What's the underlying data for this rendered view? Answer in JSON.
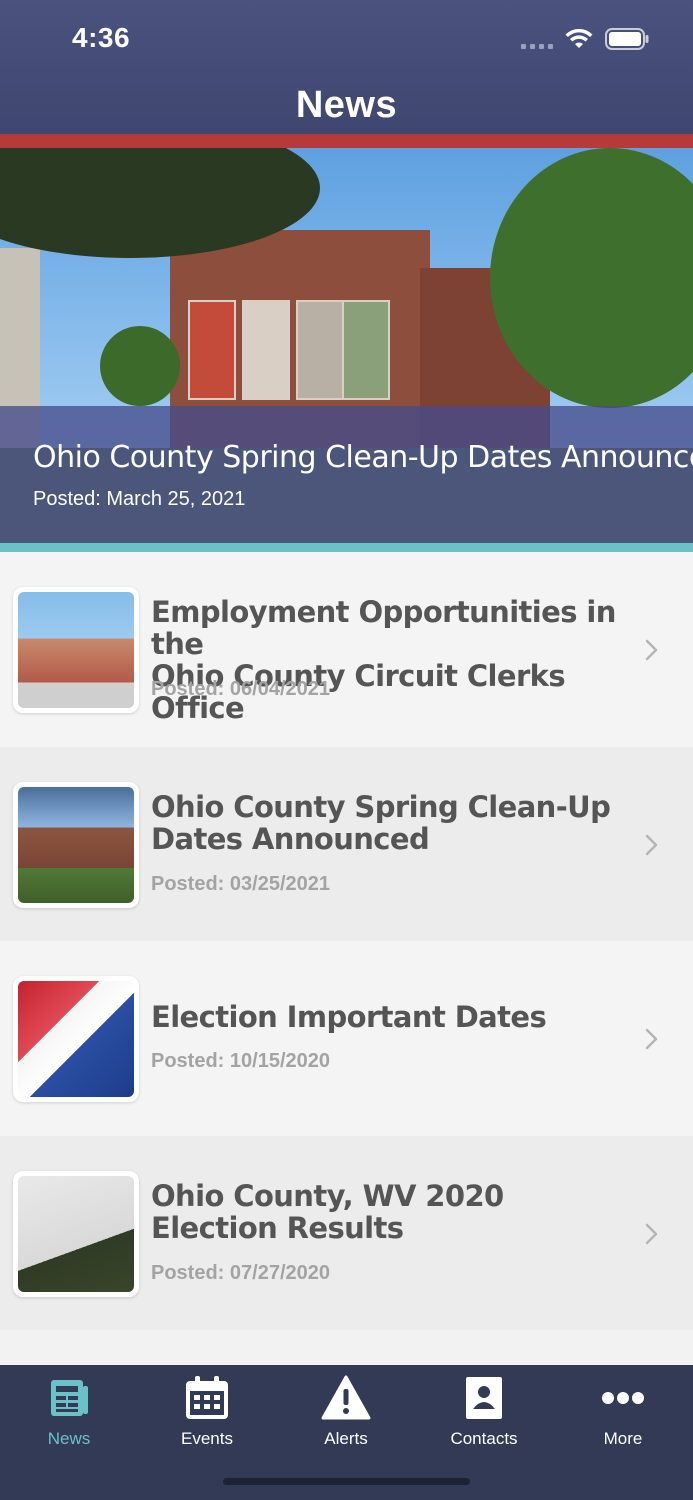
{
  "status_bar": {
    "time": "4:36"
  },
  "header": {
    "title": "News"
  },
  "featured": {
    "title": "Ohio County Spring Clean-Up Dates Announced",
    "date": "Posted: March 25, 2021"
  },
  "news_items": [
    {
      "title_line1": "Employment Opportunities in the",
      "title_line2": "Ohio County Circuit Clerks Office",
      "date": "Posted: 06/04/2021"
    },
    {
      "title_line1": "Ohio County Spring Clean-Up",
      "title_line2": "Dates Announced",
      "date": "Posted: 03/25/2021"
    },
    {
      "title_line1": "Election Important Dates",
      "title_line2": "",
      "date": "Posted: 10/15/2020"
    },
    {
      "title_line1": "Ohio County, WV 2020",
      "title_line2": "Election Results",
      "date": "Posted: 07/27/2020"
    }
  ],
  "tabs": [
    {
      "label": "News",
      "icon": "newspaper-icon",
      "active": true
    },
    {
      "label": "Events",
      "icon": "calendar-icon",
      "active": false
    },
    {
      "label": "Alerts",
      "icon": "warning-icon",
      "active": false
    },
    {
      "label": "Contacts",
      "icon": "contact-card-icon",
      "active": false
    },
    {
      "label": "More",
      "icon": "more-dots-icon",
      "active": false
    }
  ],
  "colors": {
    "header": "#464d78",
    "accent_red": "#b73a3a",
    "accent_teal": "#6cc0c7",
    "tabbar": "#333a56"
  }
}
